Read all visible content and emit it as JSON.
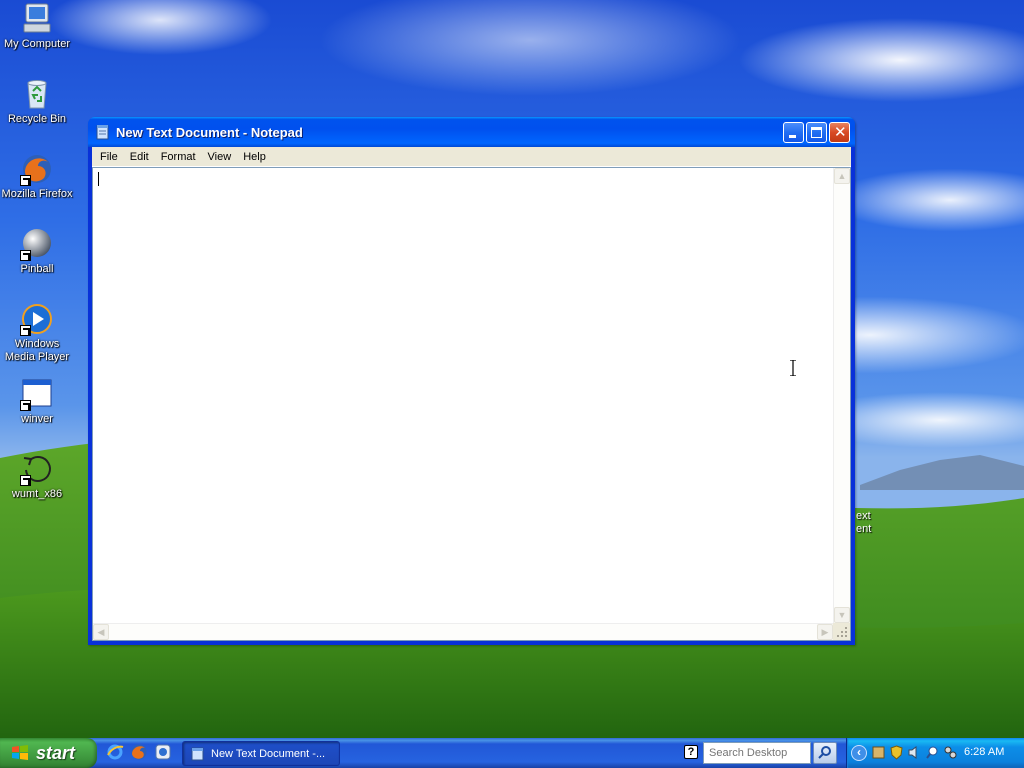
{
  "desktop": {
    "icons": [
      {
        "label": "My Computer"
      },
      {
        "label": "Recycle Bin"
      },
      {
        "label": "Mozilla Firefox"
      },
      {
        "label": "Pinball"
      },
      {
        "label": "Windows Media Player"
      },
      {
        "label": "winver"
      },
      {
        "label": "wumt_x86"
      }
    ],
    "partial_icon_label": "ext ent"
  },
  "notepad": {
    "title": "New Text Document - Notepad",
    "menu": [
      "File",
      "Edit",
      "Format",
      "View",
      "Help"
    ],
    "content": ""
  },
  "taskbar": {
    "start_label": "start",
    "quicklaunch": [
      "internet-explorer-icon",
      "firefox-icon",
      "media-icon"
    ],
    "task_button_label": "New Text Document -...",
    "search_placeholder": "Search Desktop",
    "clock": "6:28 AM"
  },
  "colors": {
    "titlebar": "#0054e3",
    "taskbar": "#245edb",
    "start_green": "#3c9a3c",
    "tray": "#0c8ee8"
  }
}
